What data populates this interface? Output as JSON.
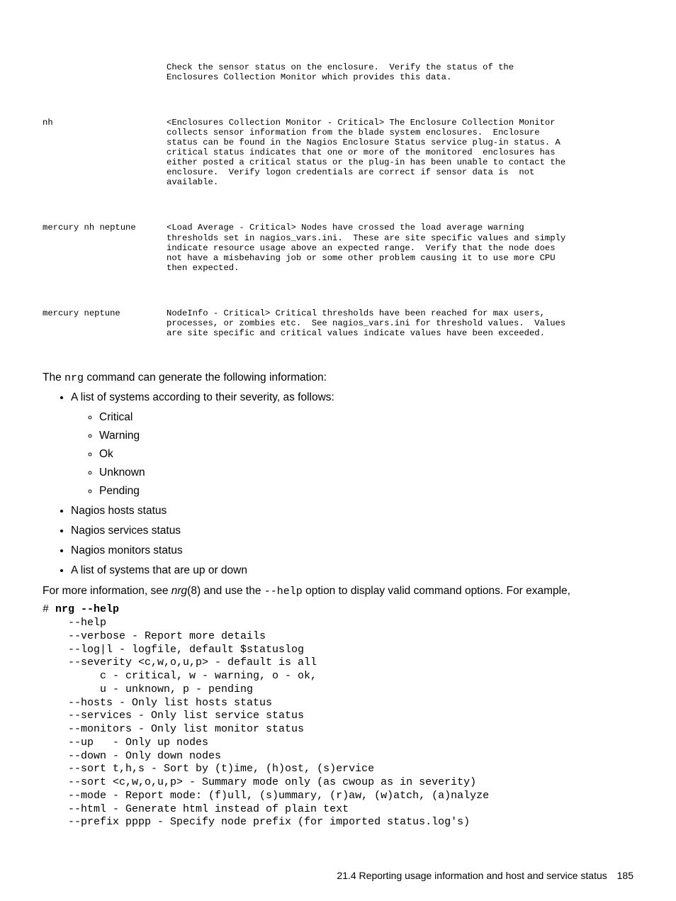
{
  "table": {
    "r0": {
      "col1": "",
      "col2": "Check the sensor status on the enclosure.  Verify the status of the Enclosures Collection Monitor which provides this data."
    },
    "r1": {
      "col1": "nh",
      "col2": "<Enclosures Collection Monitor - Critical> The Enclosure Collection Monitor collects sensor information from the blade system enclosures.  Enclosure status can be found in the Nagios Enclosure Status service plug-in status. A critical status indicates that one or more of the monitored  enclosures has either posted a critical status or the plug-in has been unable to contact the enclosure.  Verify logon credentials are correct if sensor data is  not available."
    },
    "r2": {
      "col1": "mercury nh neptune",
      "col2": "<Load Average - Critical> Nodes have crossed the load average warning thresholds set in nagios_vars.ini.  These are site specific values and simply indicate resource usage above an expected range.  Verify that the node does not have a misbehaving job or some other problem causing it to use more CPU then expected."
    },
    "r3": {
      "col1": "mercury neptune",
      "col2": "NodeInfo - Critical> Critical thresholds have been reached for max users, processes, or zombies etc.  See nagios_vars.ini for threshold values.  Values are site specific and critical values indicate values have been exceeded."
    }
  },
  "para1_a": "The ",
  "para1_cmd": "nrg",
  "para1_b": " command can generate the following information:",
  "list": {
    "i0": "A list of systems according to their severity, as follows:",
    "sub": {
      "s0": "Critical",
      "s1": "Warning",
      "s2": "Ok",
      "s3": "Unknown",
      "s4": "Pending"
    },
    "i1": "Nagios hosts status",
    "i2": "Nagios services status",
    "i3": "Nagios monitors status",
    "i4": "A list of systems that are up or down"
  },
  "para2_a": "For more information, see ",
  "para2_it": "nrg",
  "para2_b": "(8) and use the ",
  "para2_code": "--help",
  "para2_c": " option to display valid command options. For example,",
  "code": {
    "l0": "# ",
    "l0b": "nrg --help",
    "l1": "    --help",
    "l2": "    --verbose - Report more details",
    "l3": "    --log|l - logfile, default $statuslog",
    "l4": "    --severity <c,w,o,u,p> - default is all",
    "l5": "         c - critical, w - warning, o - ok,",
    "l6": "         u - unknown, p - pending",
    "l7": "    --hosts - Only list hosts status",
    "l8": "    --services - Only list service status",
    "l9": "    --monitors - Only list monitor status",
    "l10": "    --up   - Only up nodes",
    "l11": "    --down - Only down nodes",
    "l12": "    --sort t,h,s - Sort by (t)ime, (h)ost, (s)ervice",
    "l13": "    --sort <c,w,o,u,p> - Summary mode only (as cwoup as in severity)",
    "l14": "    --mode - Report mode: (f)ull, (s)ummary, (r)aw, (w)atch, (a)nalyze",
    "l15": "    --html - Generate html instead of plain text",
    "l16": "    --prefix pppp - Specify node prefix (for imported status.log's)"
  },
  "footer": {
    "section": "21.4 Reporting usage information and host and service status",
    "page": "185"
  }
}
